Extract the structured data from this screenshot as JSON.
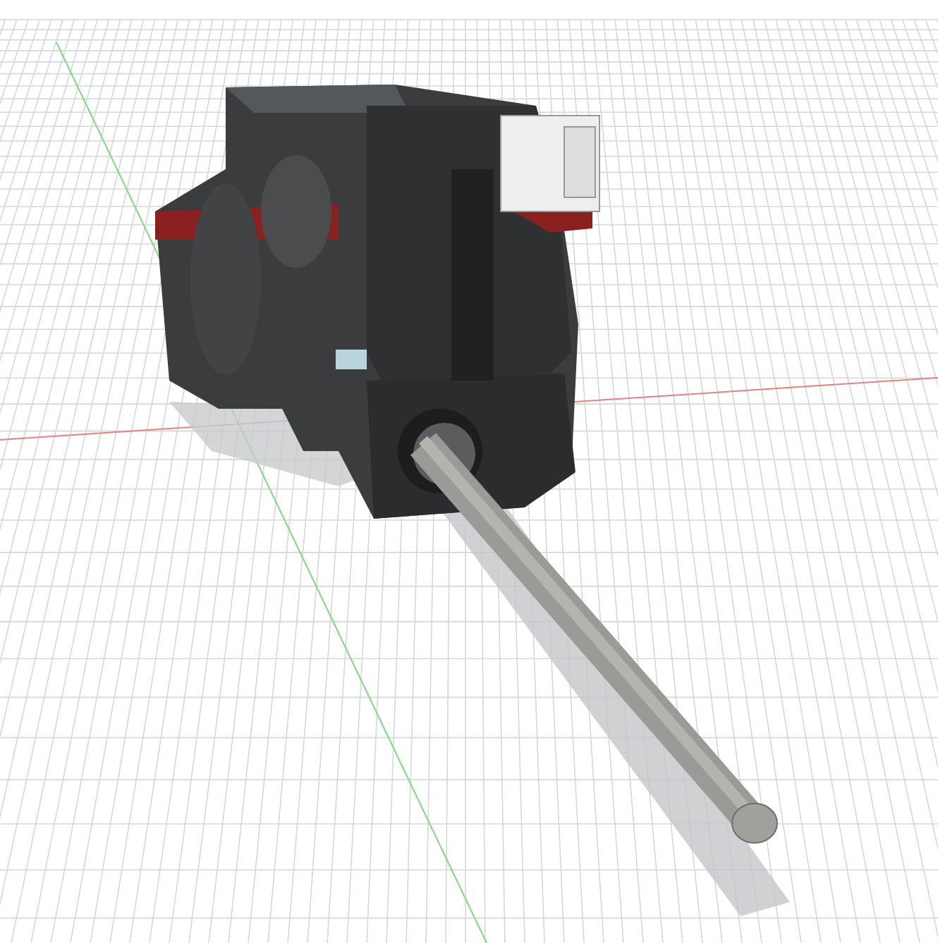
{
  "viewport": {
    "grid": true,
    "axes": [
      {
        "kind": "x",
        "color": "#e88080"
      },
      {
        "kind": "y",
        "color": "#7ed87e"
      }
    ]
  }
}
